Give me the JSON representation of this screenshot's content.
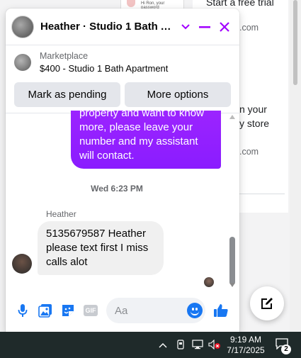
{
  "background": {
    "tagline": "Start a free trial",
    "domain1": ".com",
    "line_a": "n your",
    "line_b": "y store",
    "domain2": ".com",
    "thumbnail_text": "Hi Ron, your password"
  },
  "chat": {
    "title": "Heather · Studio 1 Bath Ap...",
    "accent_color": "#a100ff",
    "marketplace": {
      "label": "Marketplace",
      "item": "$400 - Studio 1 Bath Apartment",
      "buttons": [
        "Mark as pending",
        "More options"
      ]
    },
    "messages": {
      "outgoing_text": "property and want to know more, please leave your number and my assistant will contact.",
      "timestamp": "Wed 6:23 PM",
      "sender": "Heather",
      "incoming_text": "5135679587 Heather please text first I miss calls alot"
    },
    "composer": {
      "placeholder": "Aa",
      "icons": [
        "microphone-icon",
        "photo-icon",
        "sticker-icon",
        "gif-icon",
        "emoji-icon",
        "like-icon"
      ],
      "gif_label": "GIF"
    }
  },
  "taskbar": {
    "time": "9:19 AM",
    "date": "7/17/2025",
    "notification_count": "2"
  }
}
